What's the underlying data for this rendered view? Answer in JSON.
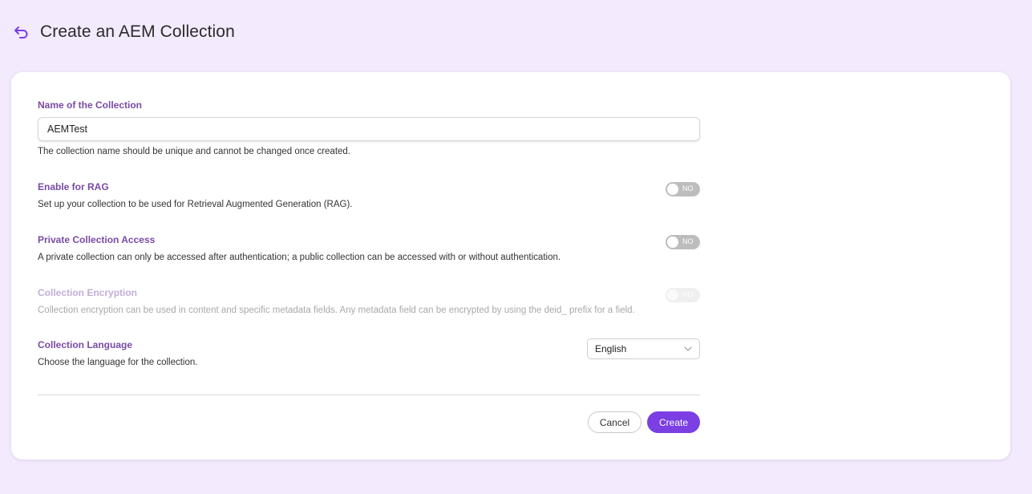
{
  "header": {
    "back_icon": "undo-arrow-icon",
    "title": "Create an AEM Collection"
  },
  "form": {
    "name": {
      "label": "Name of the Collection",
      "value": "AEMTest",
      "help": "The collection name should be unique and cannot be changed once created."
    },
    "rag": {
      "label": "Enable for RAG",
      "help": "Set up your collection to be used for Retrieval Augmented Generation (RAG).",
      "toggle_state": "NO"
    },
    "private_access": {
      "label": "Private Collection Access",
      "help": "A private collection can only be accessed after authentication; a public collection can be accessed with or without authentication.",
      "toggle_state": "NO"
    },
    "encryption": {
      "label": "Collection Encryption",
      "help": "Collection encryption can be used in content and specific metadata fields. Any metadata field can be encrypted by using the deid_ prefix for a field.",
      "toggle_state": "NO",
      "disabled": true
    },
    "language": {
      "label": "Collection Language",
      "help": "Choose the language for the collection.",
      "selected": "English"
    }
  },
  "actions": {
    "cancel_label": "Cancel",
    "create_label": "Create"
  },
  "colors": {
    "page_bg": "#f3eafd",
    "label": "#7a4aa6",
    "accent": "#7b3fe4",
    "toggle_off": "#bdbdbd"
  }
}
